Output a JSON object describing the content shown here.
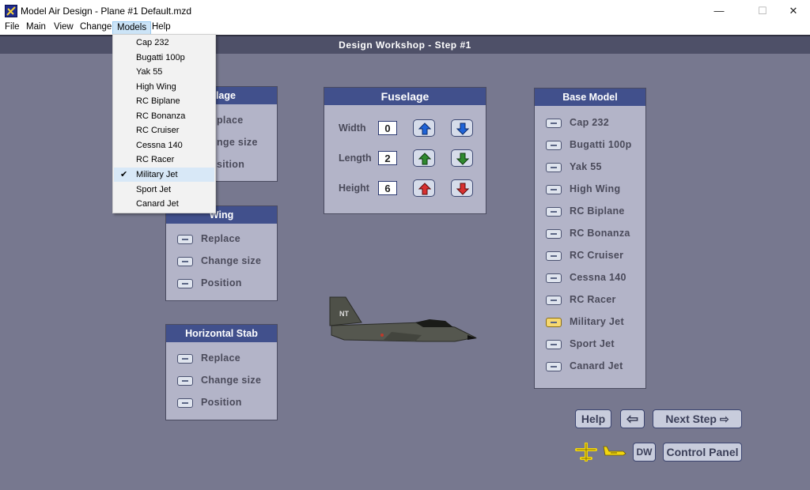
{
  "window": {
    "title": "Model Air Design - Plane #1  Default.mzd",
    "minimize": "—",
    "maximize": "☐",
    "close": "✕"
  },
  "menu": {
    "items": [
      "File",
      "Main",
      "View",
      "Change",
      "Models",
      "Help"
    ],
    "active": "Models"
  },
  "header": {
    "title": "Design Workshop  -  Step #1"
  },
  "models_menu": {
    "items": [
      "Cap 232",
      "Bugatti 100p",
      "Yak 55",
      "High Wing",
      "RC Biplane",
      "RC Bonanza",
      "RC Cruiser",
      "Cessna 140",
      "RC Racer",
      "Military Jet",
      "Sport Jet",
      "Canard Jet"
    ],
    "checked": "Military Jet"
  },
  "panels": {
    "fuselage_options": {
      "title": "Fuselage",
      "visible_title": "elage",
      "options": [
        "Replace",
        "Change size",
        "Position"
      ],
      "visible_options": [
        "place",
        "nge size",
        "sition"
      ]
    },
    "wing": {
      "title": "Wing",
      "options": [
        "Replace",
        "Change size",
        "Position"
      ]
    },
    "horizontal_stab": {
      "title": "Horizontal Stab",
      "options": [
        "Replace",
        "Change size",
        "Position"
      ]
    },
    "fuselage_dims": {
      "title": "Fuselage",
      "rows": [
        {
          "label": "Width",
          "value": "0",
          "color": "#1f64d8"
        },
        {
          "label": "Length",
          "value": "2",
          "color": "#2f8a2f"
        },
        {
          "label": "Height",
          "value": "6",
          "color": "#d83030"
        }
      ]
    },
    "base_model": {
      "title": "Base Model",
      "items": [
        "Cap 232",
        "Bugatti 100p",
        "Yak 55",
        "High Wing",
        "RC Biplane",
        "RC Bonanza",
        "RC Cruiser",
        "Cessna 140",
        "RC Racer",
        "Military Jet",
        "Sport Jet",
        "Canard Jet"
      ],
      "selected": "Military Jet"
    }
  },
  "plane": {
    "tail_text": "NT"
  },
  "buttons": {
    "help": "Help",
    "back": "⇦",
    "next": "Next Step ⇨",
    "dw": "DW",
    "control_panel": "Control Panel"
  },
  "icons": [
    "app-icon",
    "plane-view-top-icon",
    "plane-view-side-icon",
    "arrow-up-icon",
    "arrow-down-icon",
    "check-icon"
  ],
  "colors": {
    "panel_header": "#41508c",
    "background": "#77788f",
    "selected_option": "#f6d870"
  }
}
